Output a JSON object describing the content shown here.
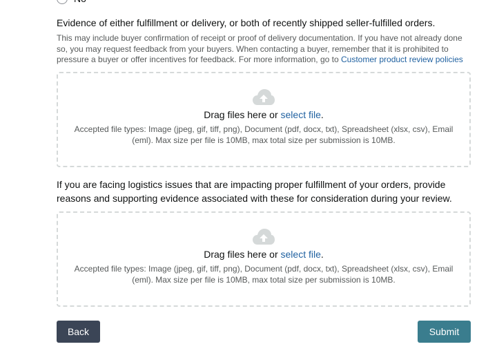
{
  "radio_option": {
    "label": "No"
  },
  "evidence_section": {
    "heading": "Evidence of either fulfillment or delivery, or both of recently shipped seller-fulfilled orders.",
    "help_text": "This may include buyer confirmation of receipt or proof of delivery documentation. If you have not already done so, you may request feedback from your buyers. When contacting a buyer, remember that it is prohibited to pressure a buyer or offer incentives for feedback. For more information, go to",
    "help_link": "Customer product review policies"
  },
  "logistics_section": {
    "heading": "If you are facing logistics issues that are impacting proper fulfillment of your orders, provide reasons and supporting evidence associated with these for consideration during your review."
  },
  "dropzones": [
    {
      "drag_text": "Drag files here or",
      "select_link": "select file",
      "accepted": "Accepted file types: Image (jpeg, gif, tiff, png), Document (pdf, docx, txt), Spreadsheet (xlsx, csv), Email (eml). Max size per file is 10MB, max total size per submission is 10MB."
    },
    {
      "drag_text": "Drag files here or",
      "select_link": "select file",
      "accepted": "Accepted file types: Image (jpeg, gif, tiff, png), Document (pdf, docx, txt), Spreadsheet (xlsx, csv), Email (eml). Max size per file is 10MB, max total size per submission is 10MB."
    }
  ],
  "buttons": {
    "back": "Back",
    "submit": "Submit"
  },
  "icons": {
    "upload": "cloud-upload-icon"
  },
  "colors": {
    "link": "#2162a1",
    "back_button": "#3b4556",
    "submit_button": "#3a7d8e",
    "dropzone_border": "#d5d9d9"
  }
}
